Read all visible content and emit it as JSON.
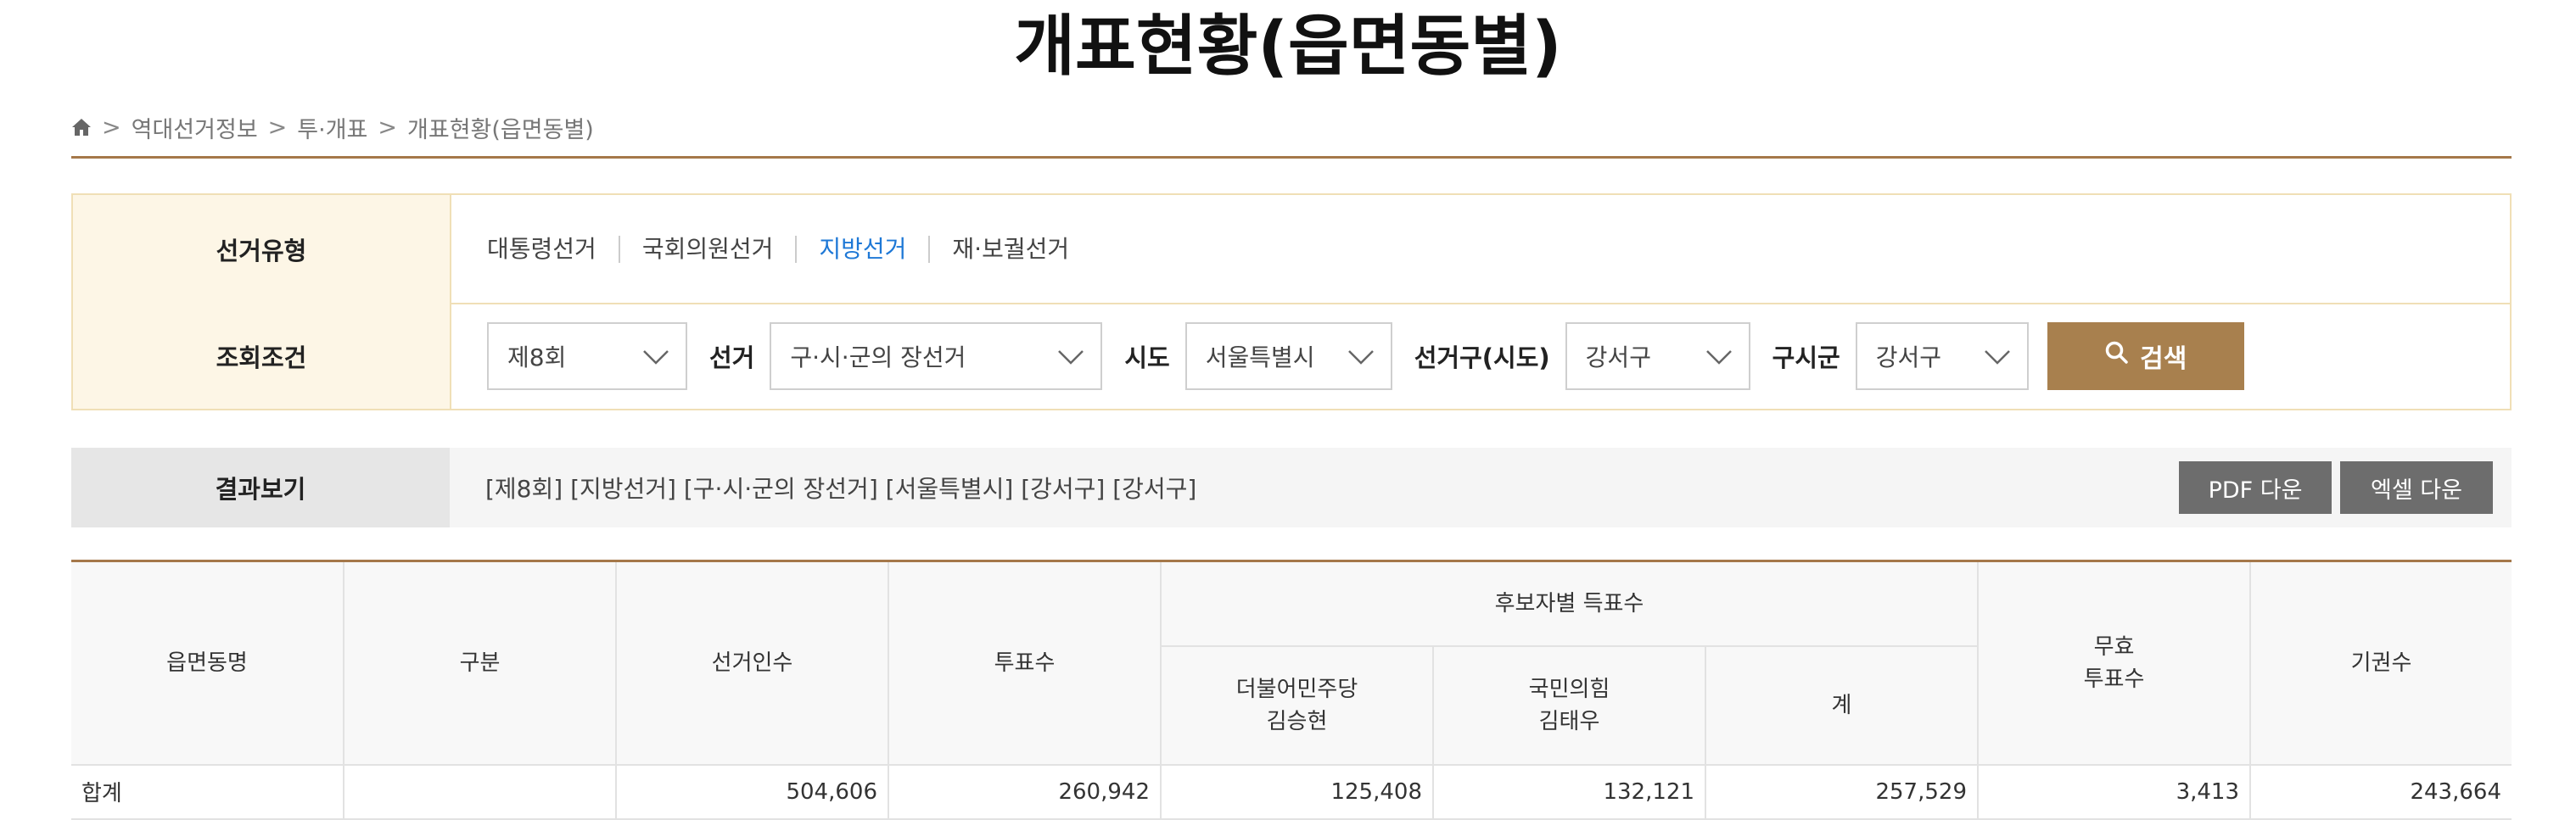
{
  "page": {
    "title": "개표현황(읍면동별)"
  },
  "breadcrumb": {
    "items": [
      "역대선거정보",
      "투·개표",
      "개표현황(읍면동별)"
    ],
    "separator": ">"
  },
  "search": {
    "election_type_label": "선거유형",
    "election_types": [
      {
        "label": "대통령선거",
        "active": false
      },
      {
        "label": "국회의원선거",
        "active": false
      },
      {
        "label": "지방선거",
        "active": true
      },
      {
        "label": "재·보궐선거",
        "active": false
      }
    ],
    "condition_label": "조회조건",
    "round_value": "제8회",
    "election_label": "선거",
    "election_value": "구·시·군의 장선거",
    "sido_label": "시도",
    "sido_value": "서울특별시",
    "district_label": "선거구(시도)",
    "district_value": "강서구",
    "gusigun_label": "구시군",
    "gusigun_value": "강서구",
    "search_button": "검색"
  },
  "result": {
    "label": "결과보기",
    "summary": "[제8회] [지방선거] [구·시·군의 장선거] [서울특별시] [강서구] [강서구]",
    "pdf_button": "PDF 다운",
    "excel_button": "엑셀 다운"
  },
  "table": {
    "headers": {
      "eupmyeondong": "읍면동명",
      "category": "구분",
      "electorate": "선거인수",
      "votes": "투표수",
      "candidate_group": "후보자별 득표수",
      "candidate1_party": "더불어민주당",
      "candidate1_name": "김승현",
      "candidate2_party": "국민의힘",
      "candidate2_name": "김태우",
      "total": "계",
      "invalid_line1": "무효",
      "invalid_line2": "투표수",
      "abstention": "기권수"
    },
    "rows": [
      {
        "eupmyeondong": "합계",
        "category": "",
        "electorate": "504,606",
        "votes": "260,942",
        "candidate1": "125,408",
        "candidate2": "132,121",
        "total": "257,529",
        "invalid": "3,413",
        "abstention": "243,664"
      }
    ]
  },
  "colors": {
    "accent_brown": "#a5784a",
    "active_link": "#1e78d6",
    "search_button": "#a8804e",
    "download_button": "#6d6d6d"
  },
  "icons": {
    "home": "home-icon",
    "chevron": "chevron-down-icon",
    "search": "search-icon"
  }
}
